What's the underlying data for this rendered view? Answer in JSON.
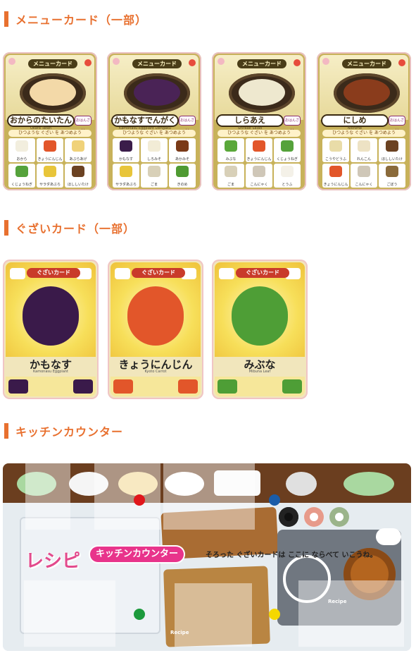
{
  "sections": {
    "menu": "メニューカード（一部）",
    "ingredients": "ぐざいカード（一部）",
    "kitchen": "キッチンカウンター"
  },
  "menu_cards": [
    {
      "banner": "メニューカード",
      "name": "おからのたいたん",
      "sub": "Okara Tatan",
      "dish_btn": "おはんざい",
      "need": "ひつような ぐざい を あつめよう",
      "ingredients": [
        {
          "label": "おから",
          "color": "#f2eede"
        },
        {
          "label": "きょうにんじん",
          "color": "#e2562a"
        },
        {
          "label": "あぶらあげ",
          "color": "#f0d27a"
        },
        {
          "label": "くじょうねぎ",
          "color": "#55a23b"
        },
        {
          "label": "サラダあぶら",
          "color": "#e8c53a"
        },
        {
          "label": "ほししいたけ",
          "color": "#6b4222"
        }
      ],
      "food": "#f3d9a8"
    },
    {
      "banner": "メニューカード",
      "name": "かもなすでんがく",
      "sub": "Kamonasu Eggplant Dengaku",
      "dish_btn": "おはんざい",
      "need": "ひつような ぐざい を あつめよう",
      "ingredients": [
        {
          "label": "かもなす",
          "color": "#3b1d4a"
        },
        {
          "label": "しろみそ",
          "color": "#f2ecd6"
        },
        {
          "label": "あかみそ",
          "color": "#7a3a18"
        },
        {
          "label": "サラダあぶら",
          "color": "#e8c53a"
        },
        {
          "label": "ごま",
          "color": "#d8d0b8"
        },
        {
          "label": "きのめ",
          "color": "#4f9a32"
        }
      ],
      "food": "#4a2356"
    },
    {
      "banner": "メニューカード",
      "name": "しらあえ",
      "sub": "Shiraae Salad",
      "dish_btn": "おはんざい",
      "need": "ひつような ぐざい を あつめよう",
      "ingredients": [
        {
          "label": "みぶな",
          "color": "#5aa83a"
        },
        {
          "label": "きょうにんじん",
          "color": "#e2562a"
        },
        {
          "label": "くじょうねぎ",
          "color": "#55a23b"
        },
        {
          "label": "ごま",
          "color": "#d8d0b8"
        },
        {
          "label": "こんにゃく",
          "color": "#cfc7b8"
        },
        {
          "label": "とうふ",
          "color": "#f4f1e8"
        }
      ],
      "food": "#eee8cf"
    },
    {
      "banner": "メニューカード",
      "name": "にしめ",
      "sub": "Nishime",
      "dish_btn": "おはんざい",
      "need": "ひつような ぐざい を あつめよう",
      "ingredients": [
        {
          "label": "こうやどうふ",
          "color": "#e9dca8"
        },
        {
          "label": "れんこん",
          "color": "#ede2c4"
        },
        {
          "label": "ほししいたけ",
          "color": "#6b4222"
        },
        {
          "label": "きょうにんじん",
          "color": "#e2562a"
        },
        {
          "label": "こんにゃく",
          "color": "#cfc7b8"
        },
        {
          "label": "ごぼう",
          "color": "#8a6a3a"
        }
      ],
      "food": "#8a3c1c"
    }
  ],
  "ingredient_cards": [
    {
      "banner": "ぐざいカード",
      "name": "かもなす",
      "sub": "Kamonasu Eggplant",
      "color": "#3a1a4a"
    },
    {
      "banner": "ぐざいカード",
      "name": "きょうにんじん",
      "sub": "Kyoto Carrot",
      "color": "#e2562a"
    },
    {
      "banner": "ぐざいカード",
      "name": "みぶな",
      "sub": "Mibuna Leaf",
      "color": "#4e9e36"
    }
  ],
  "kitchen": {
    "logo_text": "レシピ",
    "label": "キッチンカウンター",
    "caption": "そろった ぐざいカードは ここに ならべて いこうね。",
    "recipe_mark_1": "Recipe",
    "recipe_mark_2": "Recipe",
    "marker_colors": {
      "red": "#e0161b",
      "blue": "#1a5ca8",
      "green": "#1c9a3c",
      "yellow": "#f5d800"
    }
  }
}
